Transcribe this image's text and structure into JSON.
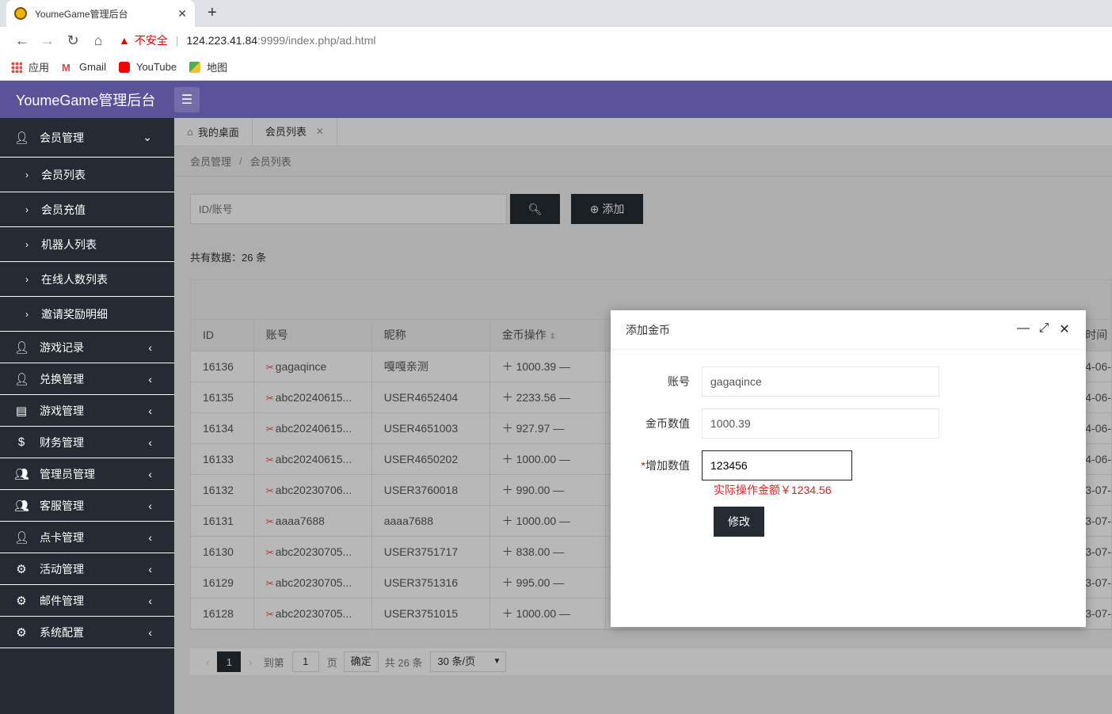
{
  "browser": {
    "tab_title": "YoumeGame管理后台",
    "insecure_label": "不安全",
    "url_host": "124.223.41.84",
    "url_rest": ":9999/index.php/ad.html",
    "bookmarks": [
      "应用",
      "Gmail",
      "YouTube",
      "地图"
    ]
  },
  "app": {
    "title": "YoumeGame管理后台"
  },
  "sidebar": {
    "member": "会员管理",
    "subs": [
      "会员列表",
      "会员充值",
      "机器人列表",
      "在线人数列表",
      "邀请奖励明细"
    ],
    "items": [
      "游戏记录",
      "兑换管理",
      "游戏管理",
      "财务管理",
      "管理员管理",
      "客服管理",
      "点卡管理",
      "活动管理",
      "邮件管理",
      "系统配置"
    ]
  },
  "tabs": {
    "desk": "我的桌面",
    "list": "会员列表"
  },
  "breadcrumb": {
    "parent": "会员管理",
    "current": "会员列表"
  },
  "search": {
    "placeholder": "ID/账号",
    "add_label": "添加"
  },
  "total": "共有数据：26 条",
  "table": {
    "headers": [
      "ID",
      "账号",
      "昵称",
      "金币操作"
    ],
    "rows": [
      {
        "id": "16136",
        "account": "gagaqince",
        "nick": "嘎嘎亲测",
        "coin": "1000.39"
      },
      {
        "id": "16135",
        "account": "abc20240615...",
        "nick": "USER4652404",
        "coin": "2233.56"
      },
      {
        "id": "16134",
        "account": "abc20240615...",
        "nick": "USER4651003",
        "coin": "927.97"
      },
      {
        "id": "16133",
        "account": "abc20240615...",
        "nick": "USER4650202",
        "coin": "1000.00"
      },
      {
        "id": "16132",
        "account": "abc20230706...",
        "nick": "USER3760018",
        "coin": "990.00"
      },
      {
        "id": "16131",
        "account": "aaaa7688",
        "nick": "aaaa7688",
        "coin": "1000.00"
      },
      {
        "id": "16130",
        "account": "abc20230705...",
        "nick": "USER3751717",
        "coin": "838.00"
      },
      {
        "id": "16129",
        "account": "abc20230705...",
        "nick": "USER3751316",
        "coin": "995.00"
      },
      {
        "id": "16128",
        "account": "abc20230705...",
        "nick": "USER3751015",
        "coin": "1000.00"
      }
    ],
    "partial_right": [
      "时间",
      "4-06-",
      "4-06-",
      "4-06-",
      "4-06-",
      "3-07-",
      "3-07-",
      "3-07-",
      "3-07-",
      "3-07-"
    ]
  },
  "pager": {
    "current": "1",
    "goto": "到第",
    "page_input": "1",
    "page_unit": "页",
    "confirm": "确定",
    "total": "共 26 条",
    "per_page": "30 条/页"
  },
  "modal": {
    "title": "添加金币",
    "account_label": "账号",
    "account_value": "gagaqince",
    "coin_label": "金币数值",
    "coin_value": "1000.39",
    "add_label": "增加数值",
    "add_value": "123456",
    "hint": "实际操作金额￥1234.56",
    "submit": "修改"
  }
}
